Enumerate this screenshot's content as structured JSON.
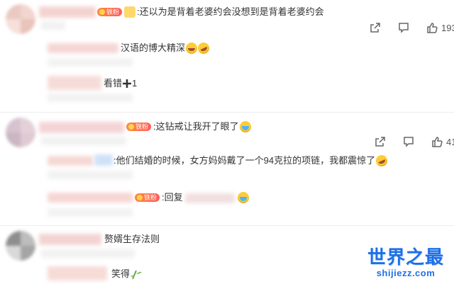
{
  "comments": [
    {
      "badge": "铁粉",
      "text": ":还以为是背着老婆约会没想到是背着老婆约会",
      "actions": {
        "share_count": "",
        "comment_count": "",
        "like_count": "193"
      },
      "replies": [
        {
          "text": "汉语的博大精深"
        },
        {
          "text": "看错",
          "more_count": "1"
        }
      ]
    },
    {
      "badge": "铁粉",
      "text": ":这钻戒让我开了眼了",
      "actions": {
        "share_count": "",
        "comment_count": "",
        "like_count": "41"
      },
      "replies": [
        {
          "text": ":他们结婚的时候，女方妈妈戴了一个94克拉的项链，我都震惊了"
        },
        {
          "badge": "铁粉",
          "text": ":回复"
        }
      ]
    },
    {
      "text": "赘婿生存法则",
      "replies": [
        {
          "text": "笑得"
        }
      ]
    }
  ],
  "watermark": {
    "title": "世界之最",
    "url": "shijiezz.com"
  },
  "colors": {
    "accent": "#1f6fe6",
    "badge": "#ff6a4d"
  }
}
